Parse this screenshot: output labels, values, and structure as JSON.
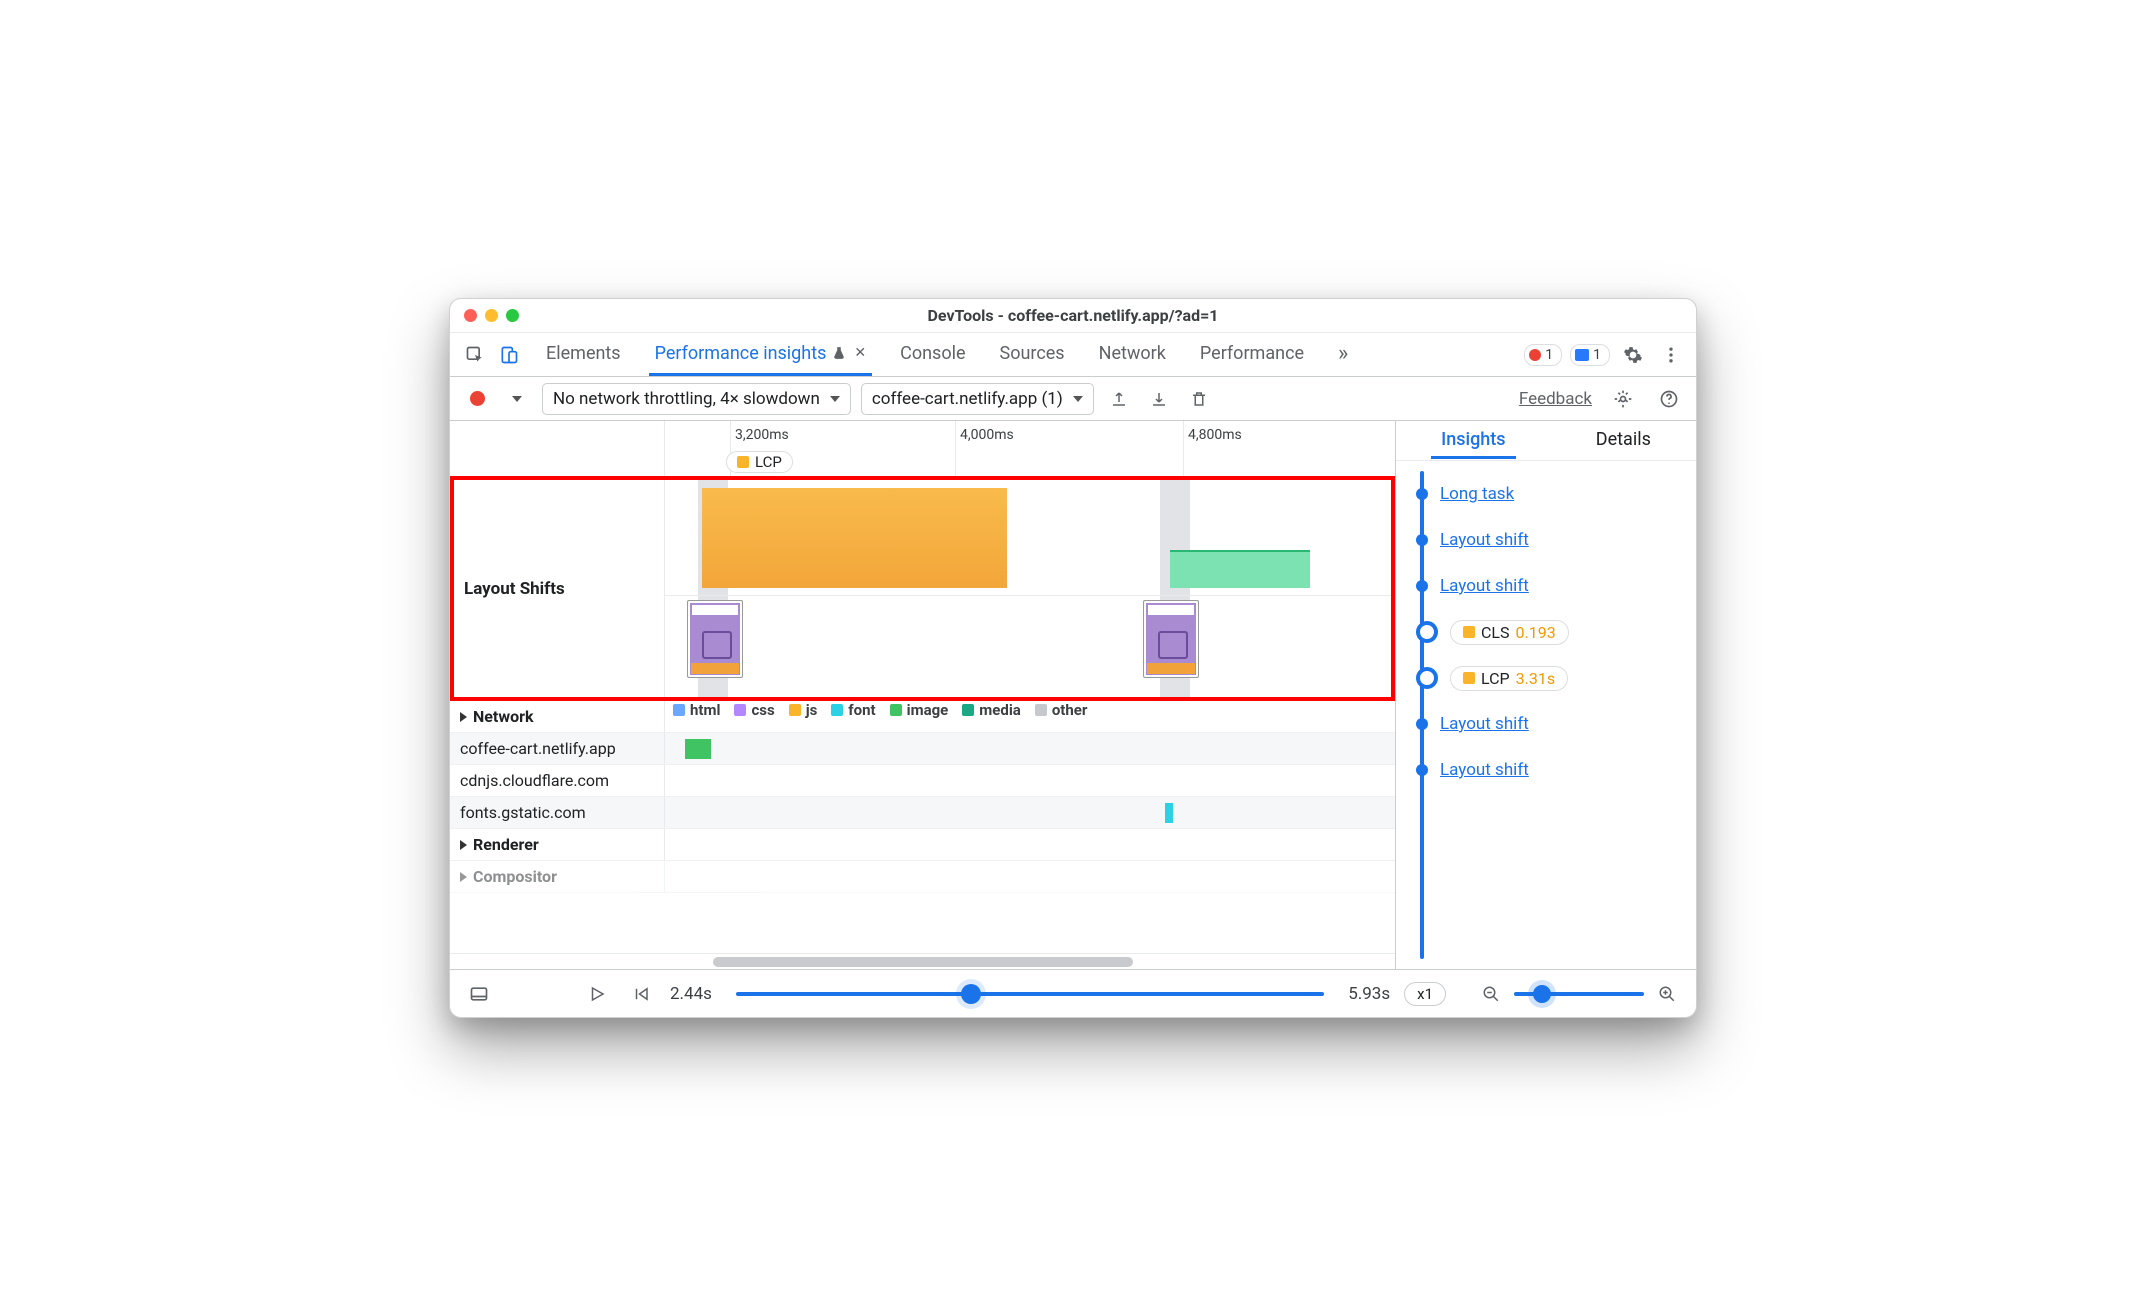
{
  "window_title": "DevTools - coffee-cart.netlify.app/?ad=1",
  "tabstrip": {
    "tabs": [
      "Elements",
      "Performance insights",
      "Console",
      "Sources",
      "Network",
      "Performance"
    ],
    "active_index": 1,
    "errors": "1",
    "issues": "1"
  },
  "toolbar": {
    "throttle": "No network throttling, 4× slowdown",
    "target": "coffee-cart.netlify.app (1)",
    "feedback": "Feedback"
  },
  "ruler": {
    "ticks": [
      "3,200ms",
      "4,000ms",
      "4,800ms"
    ],
    "lcp_chip": "LCP"
  },
  "highlighted_track": {
    "label": "Layout Shifts"
  },
  "network_track": {
    "label": "Network",
    "legend": [
      "html",
      "css",
      "js",
      "font",
      "image",
      "media",
      "other"
    ],
    "rows": [
      "coffee-cart.netlify.app",
      "cdnjs.cloudflare.com",
      "fonts.gstatic.com"
    ]
  },
  "renderer_track": {
    "label": "Renderer"
  },
  "compositor_track": {
    "label": "Compositor"
  },
  "insights_panel": {
    "tabs": [
      "Insights",
      "Details"
    ],
    "active_index": 0,
    "items": [
      {
        "type": "link",
        "label": "Long task"
      },
      {
        "type": "link",
        "label": "Layout shift"
      },
      {
        "type": "link",
        "label": "Layout shift"
      },
      {
        "type": "metric",
        "name": "CLS",
        "value": "0.193",
        "color": "orange"
      },
      {
        "type": "metric",
        "name": "LCP",
        "value": "3.31s",
        "color": "orange"
      },
      {
        "type": "link",
        "label": "Layout shift"
      },
      {
        "type": "link",
        "label": "Layout shift"
      }
    ]
  },
  "footer": {
    "start": "2.44s",
    "end": "5.93s",
    "speed": "x1"
  }
}
